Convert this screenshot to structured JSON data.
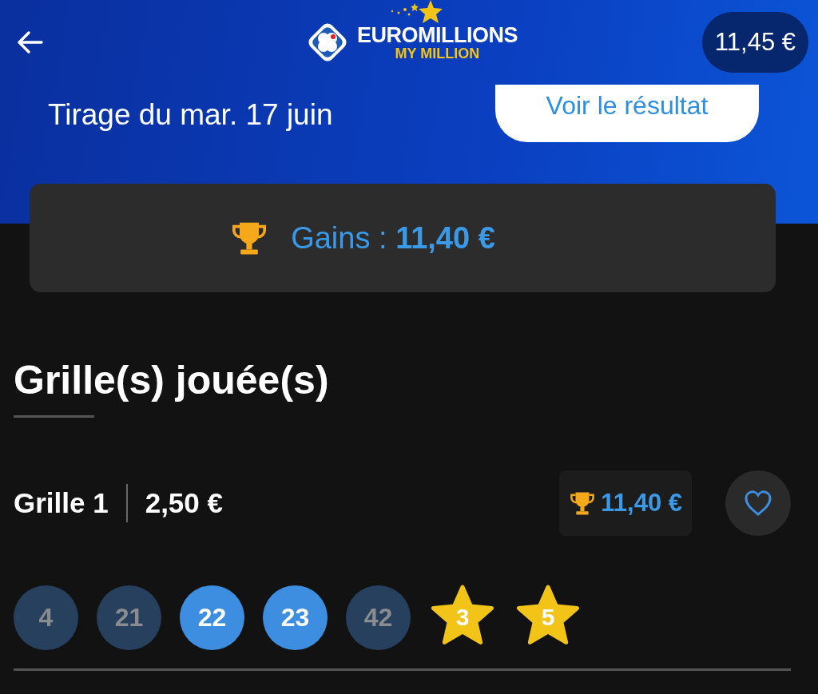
{
  "header": {
    "logo_title": "EUROMILLIONS",
    "logo_subtitle": "MY MILLION",
    "balance": "11,45 €"
  },
  "draw": {
    "label": "Tirage du mar. 17 juin",
    "button": "Voir le résultat"
  },
  "gains": {
    "label": "Gains : ",
    "amount": "11,40 €"
  },
  "section_title": "Grille(s) jouée(s)",
  "grids": [
    {
      "name": "Grille 1",
      "price": "2,50 €",
      "winnings": "11,40 €",
      "favorite": false,
      "numbers": [
        {
          "value": "4",
          "kind": "ball",
          "matched": false
        },
        {
          "value": "21",
          "kind": "ball",
          "matched": false
        },
        {
          "value": "22",
          "kind": "ball",
          "matched": true
        },
        {
          "value": "23",
          "kind": "ball",
          "matched": true
        },
        {
          "value": "42",
          "kind": "ball",
          "matched": false
        },
        {
          "value": "3",
          "kind": "star",
          "matched": true
        },
        {
          "value": "5",
          "kind": "star",
          "matched": true
        }
      ]
    }
  ]
}
